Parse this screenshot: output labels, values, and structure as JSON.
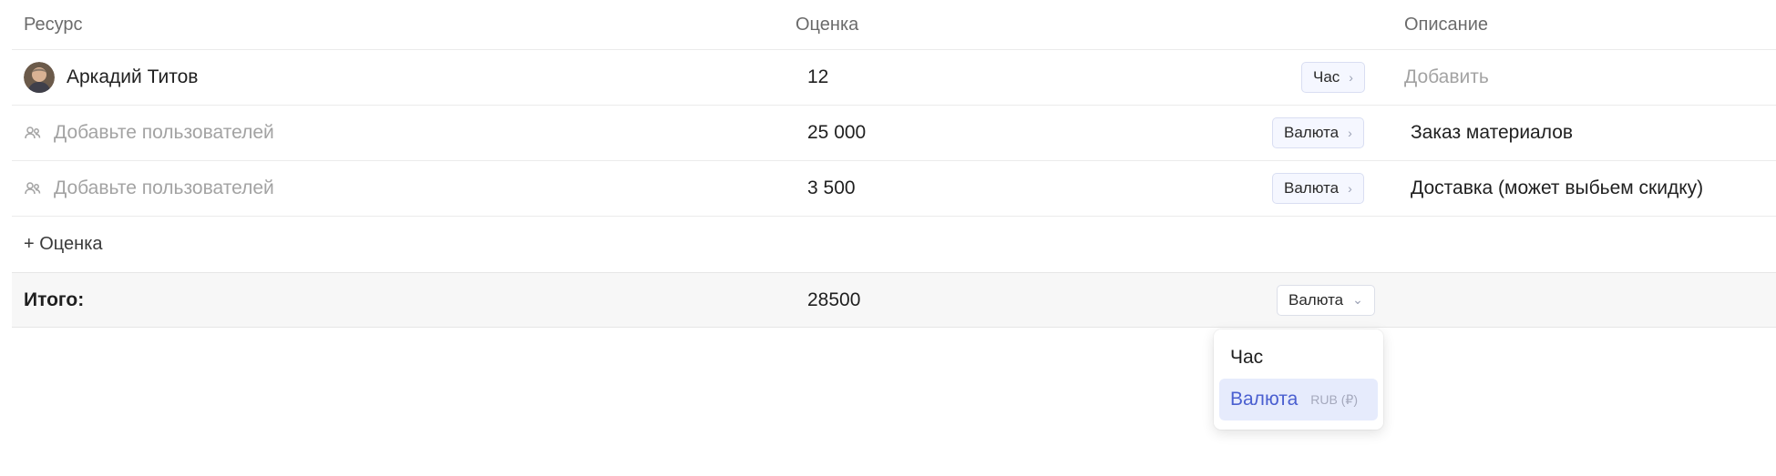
{
  "header": {
    "resource": "Ресурс",
    "estimate": "Оценка",
    "description": "Описание"
  },
  "rows": [
    {
      "resource": "Аркадий Титов",
      "value": "12",
      "unit": "Час",
      "description": "Добавить",
      "description_is_placeholder": true
    },
    {
      "resource": "Добавьте пользователей",
      "value": "25 000",
      "unit": "Валюта",
      "description": "Заказ материалов"
    },
    {
      "resource": "Добавьте пользователей",
      "value": "3 500",
      "unit": "Валюта",
      "description": "Доставка (может выбьем скидку)"
    }
  ],
  "add_estimate_label": "+ Оценка",
  "total": {
    "label": "Итого:",
    "value": "28500",
    "unit": "Валюта"
  },
  "dropdown": {
    "options": [
      {
        "label": "Час"
      },
      {
        "label": "Валюта",
        "sub": "RUB (₽)",
        "selected": true
      }
    ]
  },
  "icons": {
    "avatar": "user-avatar",
    "users": "users-icon",
    "chevron_right": "chevron-right-icon",
    "chevron_down": "chevron-down-icon"
  },
  "colors": {
    "accent": "#4a5fd0",
    "selected_bg": "#e6ebfc",
    "placeholder": "#a3a3a3"
  }
}
